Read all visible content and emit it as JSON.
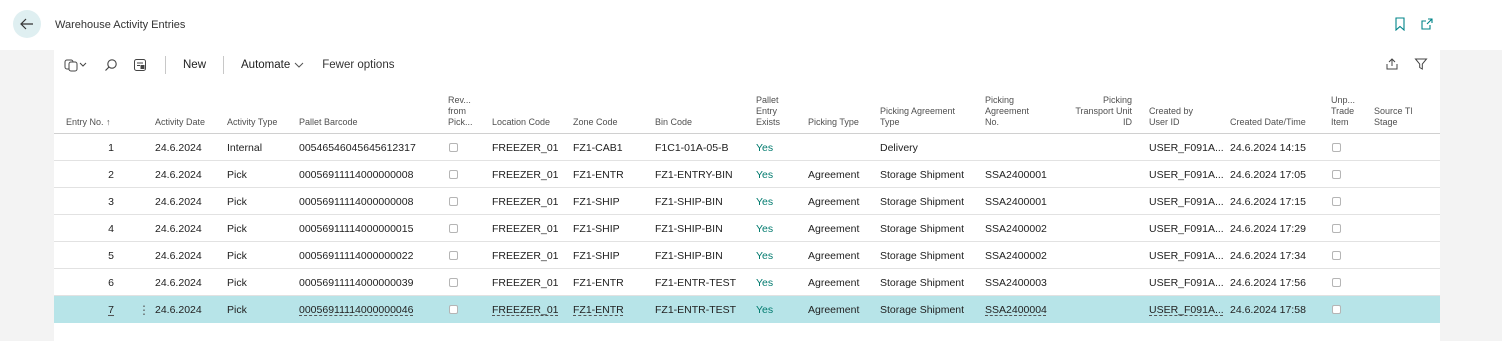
{
  "header": {
    "title": "Warehouse Activity Entries"
  },
  "actionbar": {
    "new_label": "New",
    "automate_label": "Automate",
    "fewer_label": "Fewer options"
  },
  "columns": {
    "entry_no": "Entry No. ↑",
    "activity_date": "Activity Date",
    "activity_type": "Activity Type",
    "pallet_barcode": "Pallet Barcode",
    "rev_l1": "Rev...",
    "rev_l2": "from",
    "rev_l3": "Pick...",
    "location_code": "Location Code",
    "zone_code": "Zone Code",
    "bin_code": "Bin Code",
    "pallet_l1": "Pallet",
    "pallet_l2": "Entry",
    "pallet_l3": "Exists",
    "picking_type": "Picking Type",
    "pat_l1": "Picking Agreement",
    "pat_l2": "Type",
    "pan_l1": "Picking",
    "pan_l2": "Agreement",
    "pan_l3": "No.",
    "ptu_l1": "Picking",
    "ptu_l2": "Transport Unit",
    "ptu_l3": "ID",
    "cb_l1": "Created by",
    "cb_l2": "User ID",
    "created_dt": "Created Date/Time",
    "unp_l1": "Unp...",
    "unp_l2": "Trade",
    "unp_l3": "Item",
    "st_l1": "Source Tl",
    "st_l2": "Stage"
  },
  "rows": [
    {
      "entry_no": "1",
      "activity_date": "24.6.2024",
      "activity_type": "Internal",
      "pallet_barcode": "00546546045645612317",
      "location_code": "FREEZER_01",
      "zone_code": "FZ1-CAB1",
      "bin_code": "F1C1-01A-05-B",
      "pallet_entry_exists": "Yes",
      "picking_type": "",
      "picking_agreement_type": "Delivery",
      "picking_agreement_no": "",
      "created_by": "USER_F091A...",
      "created_dt": "24.6.2024 14:15"
    },
    {
      "entry_no": "2",
      "activity_date": "24.6.2024",
      "activity_type": "Pick",
      "pallet_barcode": "00056911114000000008",
      "location_code": "FREEZER_01",
      "zone_code": "FZ1-ENTR",
      "bin_code": "FZ1-ENTRY-BIN",
      "pallet_entry_exists": "Yes",
      "picking_type": "Agreement",
      "picking_agreement_type": "Storage Shipment",
      "picking_agreement_no": "SSA2400001",
      "created_by": "USER_F091A...",
      "created_dt": "24.6.2024 17:05"
    },
    {
      "entry_no": "3",
      "activity_date": "24.6.2024",
      "activity_type": "Pick",
      "pallet_barcode": "00056911114000000008",
      "location_code": "FREEZER_01",
      "zone_code": "FZ1-SHIP",
      "bin_code": "FZ1-SHIP-BIN",
      "pallet_entry_exists": "Yes",
      "picking_type": "Agreement",
      "picking_agreement_type": "Storage Shipment",
      "picking_agreement_no": "SSA2400001",
      "created_by": "USER_F091A...",
      "created_dt": "24.6.2024 17:15"
    },
    {
      "entry_no": "4",
      "activity_date": "24.6.2024",
      "activity_type": "Pick",
      "pallet_barcode": "00056911114000000015",
      "location_code": "FREEZER_01",
      "zone_code": "FZ1-SHIP",
      "bin_code": "FZ1-SHIP-BIN",
      "pallet_entry_exists": "Yes",
      "picking_type": "Agreement",
      "picking_agreement_type": "Storage Shipment",
      "picking_agreement_no": "SSA2400002",
      "created_by": "USER_F091A...",
      "created_dt": "24.6.2024 17:29"
    },
    {
      "entry_no": "5",
      "activity_date": "24.6.2024",
      "activity_type": "Pick",
      "pallet_barcode": "00056911114000000022",
      "location_code": "FREEZER_01",
      "zone_code": "FZ1-SHIP",
      "bin_code": "FZ1-SHIP-BIN",
      "pallet_entry_exists": "Yes",
      "picking_type": "Agreement",
      "picking_agreement_type": "Storage Shipment",
      "picking_agreement_no": "SSA2400002",
      "created_by": "USER_F091A...",
      "created_dt": "24.6.2024 17:34"
    },
    {
      "entry_no": "6",
      "activity_date": "24.6.2024",
      "activity_type": "Pick",
      "pallet_barcode": "00056911114000000039",
      "location_code": "FREEZER_01",
      "zone_code": "FZ1-ENTR",
      "bin_code": "FZ1-ENTR-TEST",
      "pallet_entry_exists": "Yes",
      "picking_type": "Agreement",
      "picking_agreement_type": "Storage Shipment",
      "picking_agreement_no": "SSA2400003",
      "created_by": "USER_F091A...",
      "created_dt": "24.6.2024 17:56"
    },
    {
      "entry_no": "7",
      "activity_date": "24.6.2024",
      "activity_type": "Pick",
      "pallet_barcode": "00056911114000000046",
      "location_code": "FREEZER_01",
      "zone_code": "FZ1-ENTR",
      "bin_code": "FZ1-ENTR-TEST",
      "pallet_entry_exists": "Yes",
      "picking_type": "Agreement",
      "picking_agreement_type": "Storage Shipment",
      "picking_agreement_no": "SSA2400004",
      "created_by": "USER_F091A...",
      "created_dt": "24.6.2024 17:58"
    }
  ],
  "row7_dots": "⋮",
  "colors": {
    "accent": "#008489",
    "selected_row": "#b7e4e8",
    "back_button_bg": "#dfeff1",
    "yes_text": "#007a6e"
  }
}
